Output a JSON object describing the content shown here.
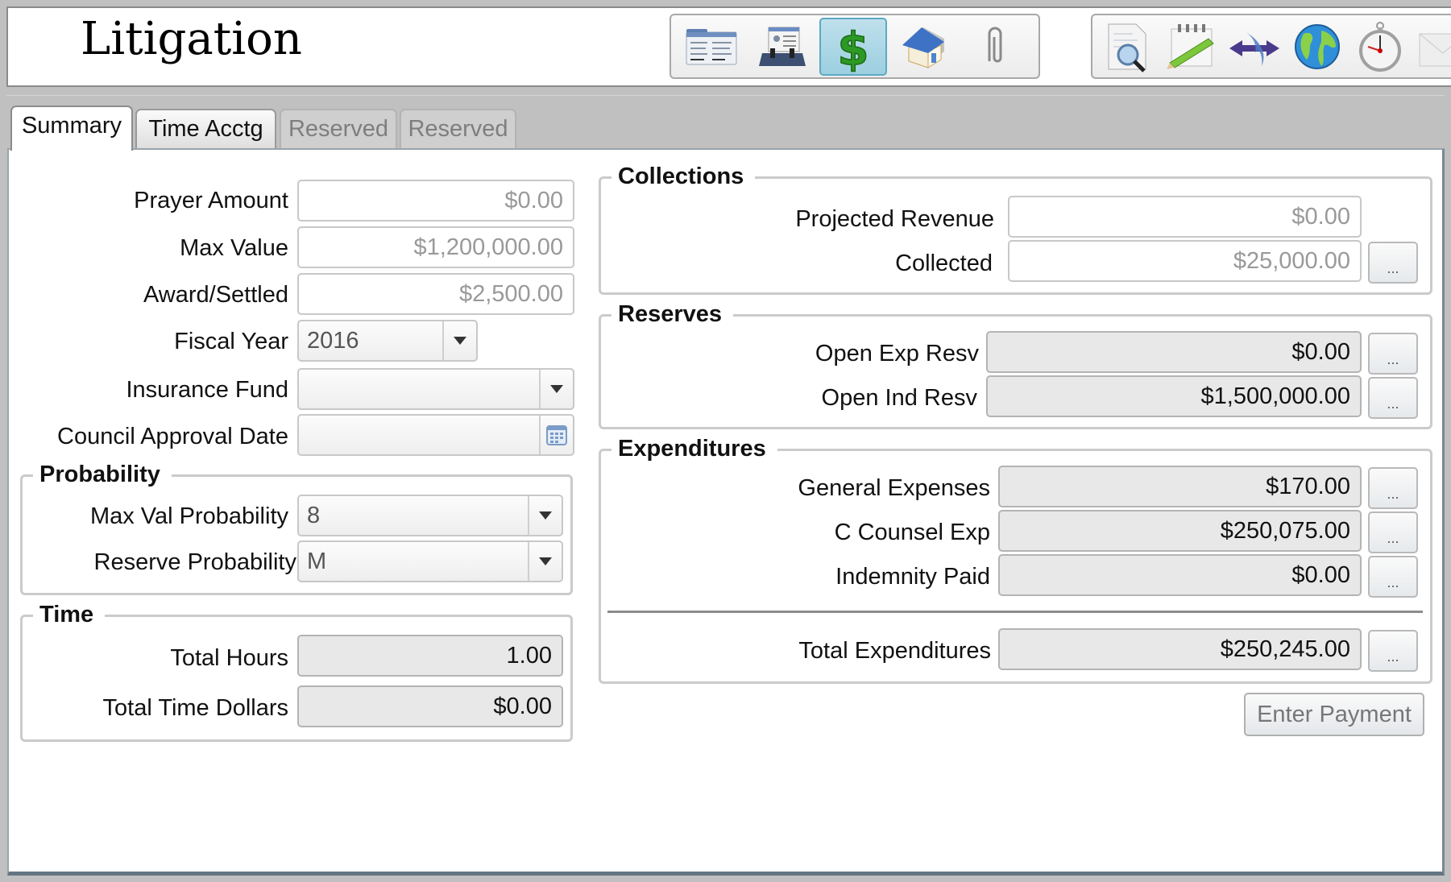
{
  "header": {
    "title": "Litigation",
    "toolbar_primary": [
      {
        "icon": "folder-form-icon",
        "tooltip": "Claim details",
        "active": false
      },
      {
        "icon": "rolodex-contact-icon",
        "tooltip": "Contacts",
        "active": false
      },
      {
        "icon": "dollar-icon",
        "tooltip": "Financials",
        "active": true
      },
      {
        "icon": "house-icon",
        "tooltip": "Property",
        "active": false
      },
      {
        "icon": "paperclip-icon",
        "tooltip": "Attachments",
        "active": false
      }
    ],
    "toolbar_secondary": [
      {
        "icon": "document-search-icon"
      },
      {
        "icon": "notepad-pencil-icon"
      },
      {
        "icon": "swap-arrows-icon"
      },
      {
        "icon": "globe-icon"
      },
      {
        "icon": "stopwatch-icon"
      },
      {
        "icon": "envelope-icon"
      }
    ],
    "active_color": "#9ccfe0"
  },
  "tabs": [
    {
      "label": "Summary",
      "state": "active"
    },
    {
      "label": "Time Acctg",
      "state": "normal"
    },
    {
      "label": "Reserved",
      "state": "disabled"
    },
    {
      "label": "Reserved",
      "state": "disabled"
    }
  ],
  "left": {
    "prayer_amount": {
      "label": "Prayer Amount",
      "value": "$0.00"
    },
    "max_value": {
      "label": "Max Value",
      "value": "$1,200,000.00"
    },
    "award_settled": {
      "label": "Award/Settled",
      "value": "$2,500.00"
    },
    "fiscal_year": {
      "label": "Fiscal Year",
      "value": "2016"
    },
    "insurance_fund": {
      "label": "Insurance Fund",
      "value": ""
    },
    "council_approval_date": {
      "label": "Council Approval Date",
      "value": ""
    },
    "probability": {
      "title": "Probability",
      "max_val_probability": {
        "label": "Max Val Probability",
        "value": "8"
      },
      "reserve_probability": {
        "label": "Reserve Probability",
        "value": "M"
      }
    },
    "time": {
      "title": "Time",
      "total_hours": {
        "label": "Total Hours",
        "value": "1.00"
      },
      "total_time_dollars": {
        "label": "Total Time Dollars",
        "value": "$0.00"
      }
    }
  },
  "right": {
    "collections": {
      "title": "Collections",
      "projected_revenue": {
        "label": "Projected Revenue",
        "value": "$0.00"
      },
      "collected": {
        "label": "Collected",
        "value": "$25,000.00"
      }
    },
    "reserves": {
      "title": "Reserves",
      "open_exp_resv": {
        "label": "Open Exp Resv",
        "value": "$0.00"
      },
      "open_ind_resv": {
        "label": "Open Ind Resv",
        "value": "$1,500,000.00"
      }
    },
    "expenditures": {
      "title": "Expenditures",
      "general_expenses": {
        "label": "General Expenses",
        "value": "$170.00"
      },
      "c_counsel_exp": {
        "label": "C Counsel Exp",
        "value": "$250,075.00"
      },
      "indemnity_paid": {
        "label": "Indemnity Paid",
        "value": "$0.00"
      },
      "total_expenditures": {
        "label": "Total Expenditures",
        "value": "$250,245.00"
      }
    },
    "ellipsis_label": "...",
    "enter_payment_label": "Enter Payment"
  }
}
